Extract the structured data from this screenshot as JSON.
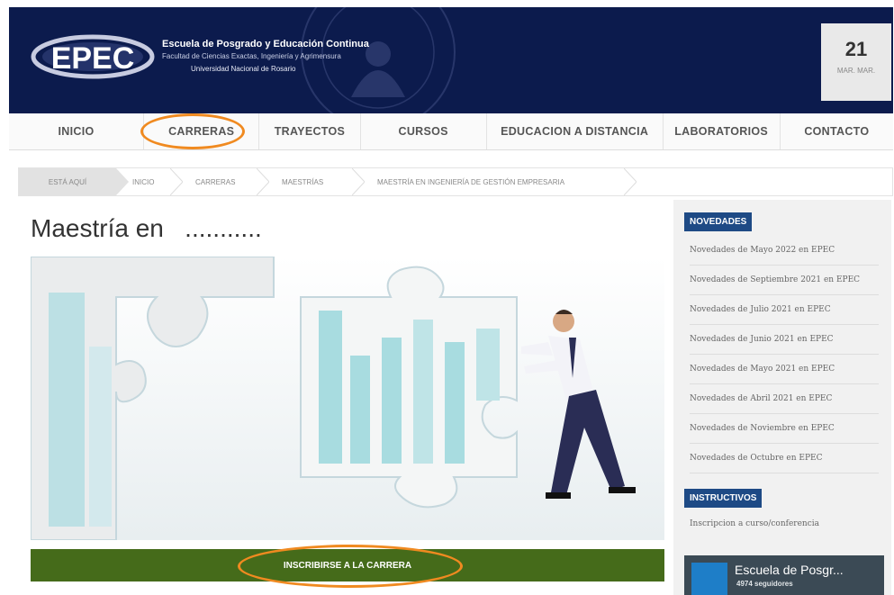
{
  "header": {
    "logo_text": "EPEC",
    "school_line1": "Escuela de Posgrado y Educación Continua",
    "school_line2": "Facultad de Ciencias Exactas, Ingeniería y Agrimensura",
    "school_line3": "Universidad Nacional de Rosario",
    "date_day": "21",
    "date_month": "MAR. MAR."
  },
  "nav": {
    "items": [
      "INICIO",
      "CARRERAS",
      "TRAYECTOS",
      "CURSOS",
      "EDUCACION A DISTANCIA",
      "LABORATORIOS",
      "CONTACTO"
    ]
  },
  "breadcrumb": {
    "here": "ESTÁ AQUÍ",
    "items": [
      "INICIO",
      "CARRERAS",
      "MAESTRÍAS",
      "MAESTRÍA EN INGENIERÍA DE GESTIÓN EMPRESARIA"
    ]
  },
  "main": {
    "title": "Maestría en   ...........",
    "signup_label": "INSCRIBIRSE A LA CARRERA"
  },
  "sidebar": {
    "novedades_label": "NOVEDADES",
    "news": [
      "Novedades de Mayo 2022 en EPEC",
      "Novedades de Septiembre 2021 en EPEC",
      "Novedades de Julio 2021 en EPEC",
      "Novedades de Junio 2021 en EPEC",
      "Novedades de Mayo 2021 en EPEC",
      "Novedades de Abril 2021 en EPEC",
      "Novedades de Noviembre en EPEC",
      "Novedades de Octubre en EPEC"
    ],
    "instructivos_label": "INSTRUCTIVOS",
    "instructivos_item": "Inscripcion a curso/conferencia",
    "fb_title": "Escuela de Posgr...",
    "fb_followers": "4974 seguidores"
  },
  "colors": {
    "header_bg": "#0c1b4d",
    "accent_blue": "#1e4a85",
    "signup_green": "#456b1a",
    "highlight_orange": "#f08a20"
  }
}
